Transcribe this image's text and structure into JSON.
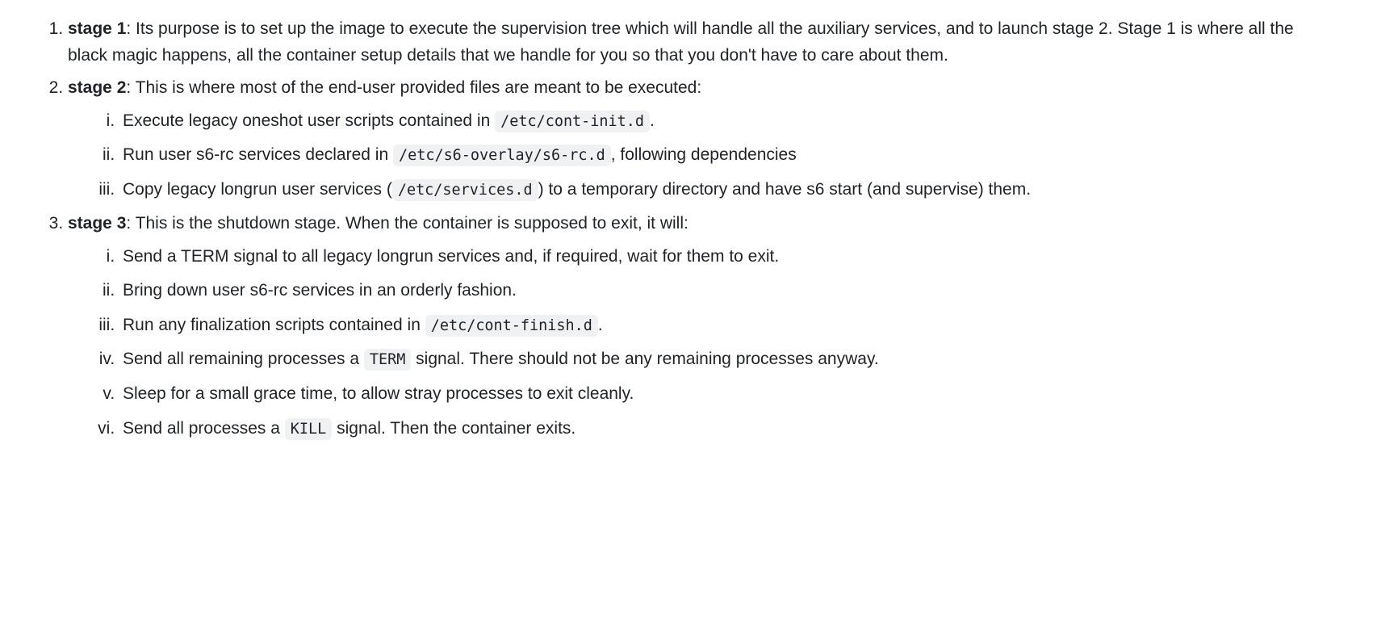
{
  "stages": [
    {
      "label": "stage 1",
      "desc": ": Its purpose is to set up the image to execute the supervision tree which will handle all the auxiliary services, and to launch stage 2. Stage 1 is where all the black magic happens, all the container setup details that we handle for you so that you don't have to care about them."
    },
    {
      "label": "stage 2",
      "desc": ": This is where most of the end-user provided files are meant to be executed:",
      "items": [
        {
          "pre": "Execute legacy oneshot user scripts contained in ",
          "code": "/etc/cont-init.d",
          "post": "."
        },
        {
          "pre": "Run user s6-rc services declared in ",
          "code": "/etc/s6-overlay/s6-rc.d",
          "post": ", following dependencies"
        },
        {
          "pre": "Copy legacy longrun user services (",
          "code": "/etc/services.d",
          "post": ") to a temporary directory and have s6 start (and supervise) them."
        }
      ]
    },
    {
      "label": "stage 3",
      "desc": ": This is the shutdown stage. When the container is supposed to exit, it will:",
      "items": [
        {
          "pre": "Send a TERM signal to all legacy longrun services and, if required, wait for them to exit.",
          "code": "",
          "post": ""
        },
        {
          "pre": "Bring down user s6-rc services in an orderly fashion.",
          "code": "",
          "post": ""
        },
        {
          "pre": "Run any finalization scripts contained in ",
          "code": "/etc/cont-finish.d",
          "post": "."
        },
        {
          "pre": "Send all remaining processes a ",
          "code": "TERM",
          "post": " signal. There should not be any remaining processes anyway."
        },
        {
          "pre": "Sleep for a small grace time, to allow stray processes to exit cleanly.",
          "code": "",
          "post": ""
        },
        {
          "pre": "Send all processes a ",
          "code": "KILL",
          "post": " signal. Then the container exits."
        }
      ]
    }
  ]
}
